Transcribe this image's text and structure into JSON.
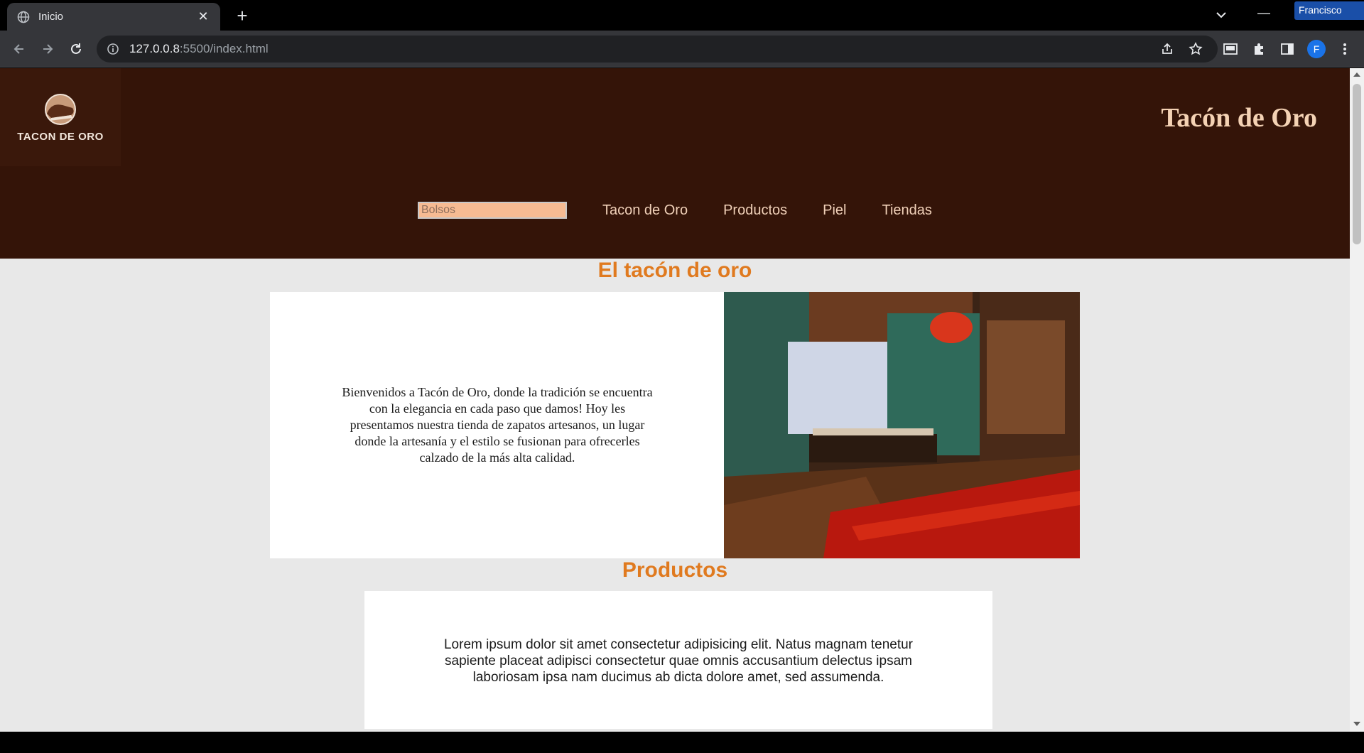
{
  "browser": {
    "tab_title": "Inicio",
    "url_host": "127.0.0.8",
    "url_path": ":5500/index.html",
    "profile_name": "Francisco",
    "avatar_letter": "F"
  },
  "header": {
    "logo_text": "TACON DE ORO",
    "brand_title": "Tacón de Oro",
    "search_placeholder": "Bolsos",
    "nav": [
      {
        "label": "Tacon de Oro"
      },
      {
        "label": "Productos"
      },
      {
        "label": "Piel"
      },
      {
        "label": "Tiendas"
      }
    ]
  },
  "intro": {
    "heading": "El tacón de oro",
    "text": "Bienvenidos a Tacón de Oro, donde la tradición se encuentra con la elegancia en cada paso que damos! Hoy les presentamos nuestra tienda de zapatos artesanos, un lugar donde la artesanía y el estilo se fusionan para ofrecerles calzado de la más alta calidad."
  },
  "products": {
    "heading": "Productos",
    "text": "Lorem ipsum dolor sit amet consectetur adipisicing elit. Natus magnam tenetur sapiente placeat adipisci consectetur quae omnis accusantium delectus ipsam laboriosam ipsa nam ducimus ab dicta dolore amet, sed assumenda."
  },
  "colors": {
    "header_bg": "#341408",
    "accent_orange": "#e07a1f",
    "brand_title": "#f4d2b4",
    "search_bg": "#f6bb93"
  }
}
